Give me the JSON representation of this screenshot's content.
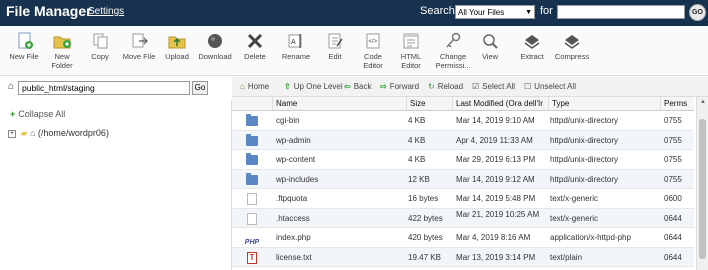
{
  "topbar": {
    "title": "File Manager",
    "settings_label": "Settings",
    "search_label": "Search",
    "search_scope": "All Your Files",
    "for_label": "for",
    "search_value": "",
    "go_label": "GO"
  },
  "toolbar": {
    "items": [
      {
        "label": "New File",
        "icon": "new-file-icon"
      },
      {
        "label": "New Folder",
        "icon": "new-folder-icon"
      },
      {
        "label": "Copy",
        "icon": "copy-icon"
      },
      {
        "label": "Move File",
        "icon": "move-file-icon"
      },
      {
        "label": "Upload",
        "icon": "upload-icon"
      },
      {
        "label": "Download",
        "icon": "download-icon"
      },
      {
        "label": "Delete",
        "icon": "delete-icon"
      },
      {
        "label": "Rename",
        "icon": "rename-icon"
      },
      {
        "label": "Edit",
        "icon": "edit-icon"
      },
      {
        "label": "Code Editor",
        "icon": "code-editor-icon"
      },
      {
        "label": "HTML Editor",
        "icon": "html-editor-icon"
      },
      {
        "label": "Change Permissi...",
        "icon": "change-permissions-icon"
      },
      {
        "label": "View",
        "icon": "view-icon"
      },
      {
        "label": "Extract",
        "icon": "extract-icon"
      },
      {
        "label": "Compress",
        "icon": "compress-icon"
      }
    ]
  },
  "path": {
    "value": "public_html/staging",
    "go_label": "Go"
  },
  "nav": {
    "home": "Home",
    "up_one_level": "Up One Level",
    "back": "Back",
    "forward": "Forward",
    "reload": "Reload",
    "select_all": "Select All",
    "unselect_all": "Unselect All"
  },
  "tree": {
    "collapse_all": "Collapse All",
    "root_label": "(/home/wordpr06)"
  },
  "table": {
    "headers": {
      "name": "Name",
      "size": "Size",
      "modified": "Last Modified (Ora dell'Ir",
      "type": "Type",
      "perms": "Perms"
    },
    "rows": [
      {
        "icon": "folder-icon",
        "name": "cgi-bin",
        "size": "4 KB",
        "modified": "Mar 14, 2019 9:10 AM",
        "type": "httpd/unix-directory",
        "perms": "0755"
      },
      {
        "icon": "folder-icon",
        "name": "wp-admin",
        "size": "4 KB",
        "modified": "Apr 4, 2019 11:33 AM",
        "type": "httpd/unix-directory",
        "perms": "0755"
      },
      {
        "icon": "folder-icon",
        "name": "wp-content",
        "size": "4 KB",
        "modified": "Mar 29, 2019 6:13 PM",
        "type": "httpd/unix-directory",
        "perms": "0755"
      },
      {
        "icon": "folder-icon",
        "name": "wp-includes",
        "size": "12 KB",
        "modified": "Mar 14, 2019 9:12 AM",
        "type": "httpd/unix-directory",
        "perms": "0755"
      },
      {
        "icon": "document-icon",
        "name": ".ftpquota",
        "size": "16 bytes",
        "modified": "Mar 14, 2019 5:48 PM",
        "type": "text/x-generic",
        "perms": "0600"
      },
      {
        "icon": "document-icon",
        "name": ".htaccess",
        "size": "422 bytes",
        "modified": "Mar 21, 2019 10:25 AM",
        "type": "text/x-generic",
        "perms": "0644"
      },
      {
        "icon": "php-icon",
        "name": "index.php",
        "size": "420 bytes",
        "modified": "Mar 4, 2019 8:16 AM",
        "type": "application/x-httpd-php",
        "perms": "0644"
      },
      {
        "icon": "text-file-icon",
        "name": "license.txt",
        "size": "19.47 KB",
        "modified": "Mar 13, 2019 3:14 PM",
        "type": "text/plain",
        "perms": "0644"
      }
    ]
  }
}
